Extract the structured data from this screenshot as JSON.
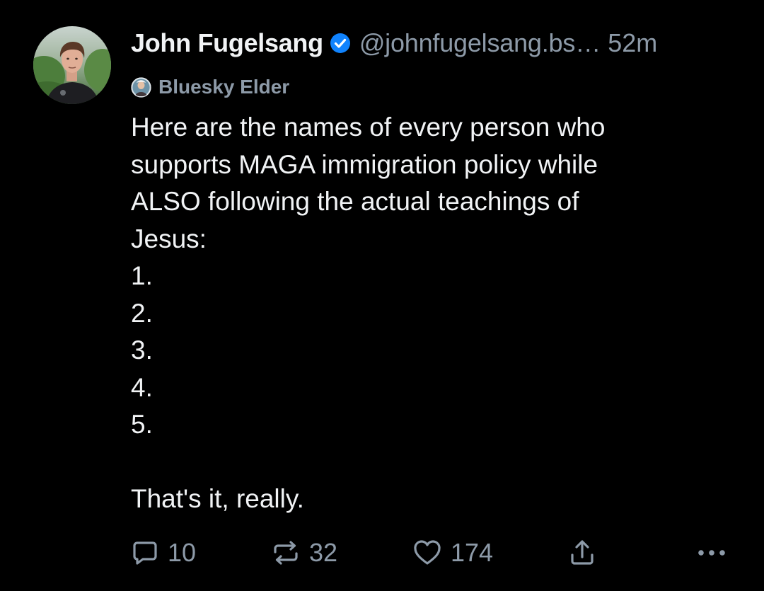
{
  "post": {
    "author": {
      "display_name": "John Fugelsang",
      "handle": "@johnfugelsang.bs",
      "handle_ellipsis": "…",
      "verified": true,
      "avatar_icon": "profile-photo"
    },
    "timestamp": "52m",
    "badge": {
      "label": "Bluesky Elder",
      "icon": "elder-badge-icon"
    },
    "text_lines": [
      "Here are the names of every person who",
      "supports MAGA immigration policy while",
      "ALSO following the actual teachings of",
      "Jesus:",
      "1.",
      "2.",
      "3.",
      "4.",
      "5.",
      "",
      "That's it, really."
    ],
    "actions": {
      "reply": {
        "icon": "reply-icon",
        "count": "10"
      },
      "repost": {
        "icon": "repost-icon",
        "count": "32"
      },
      "like": {
        "icon": "heart-icon",
        "count": "174"
      },
      "share": {
        "icon": "share-icon"
      },
      "more": {
        "icon": "more-options-icon"
      }
    }
  },
  "colors": {
    "background": "#000000",
    "primary_text": "#f1f3f5",
    "secondary_text": "#8d9aa8",
    "verified_blue": "#1083fe"
  }
}
